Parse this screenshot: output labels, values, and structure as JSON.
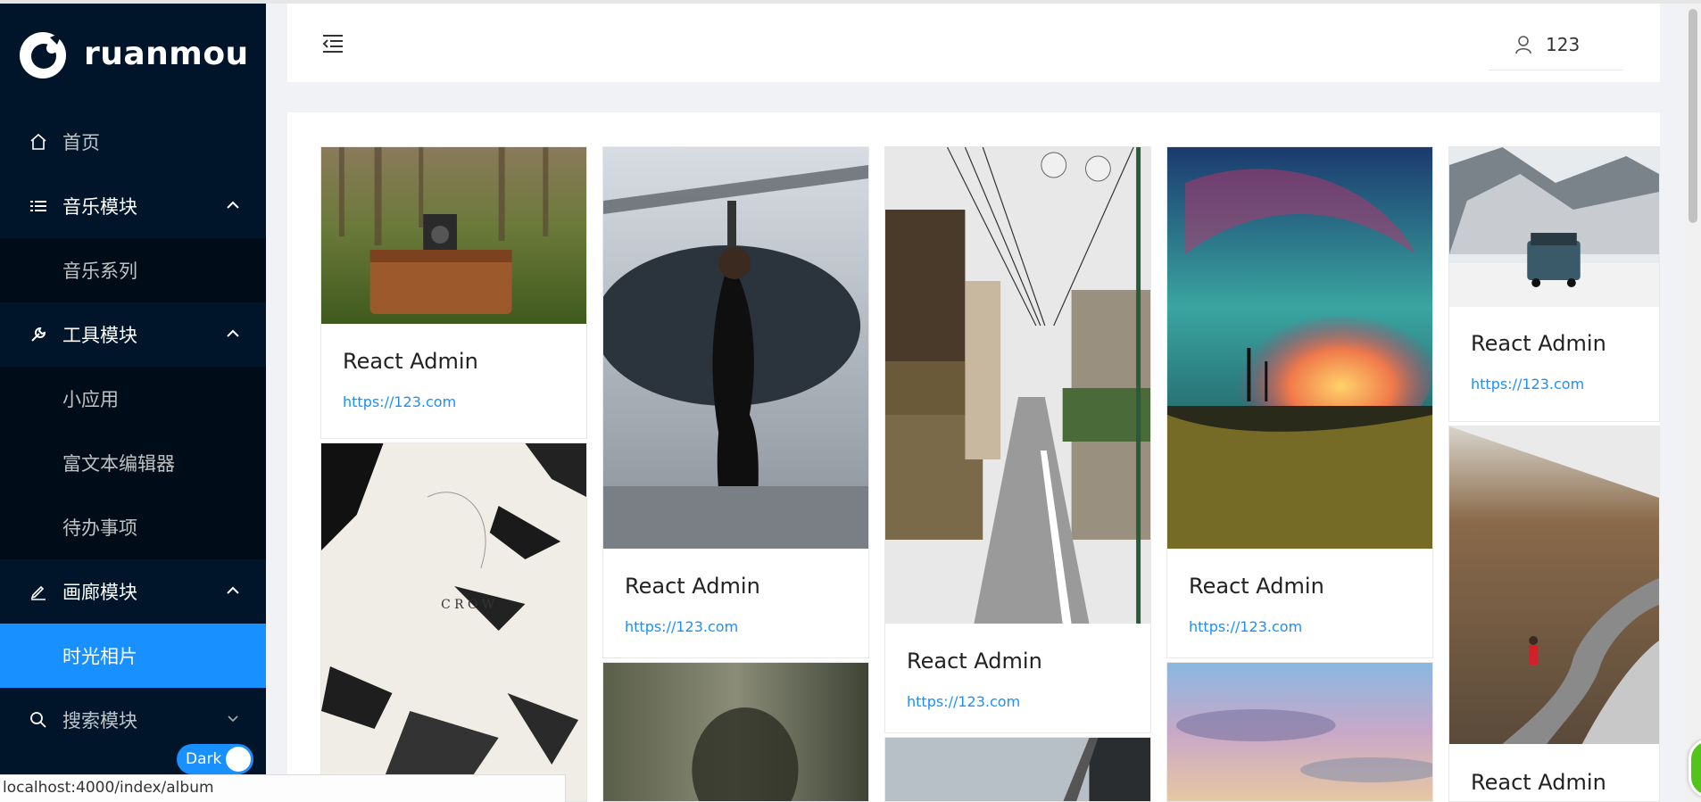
{
  "brand": {
    "name": "ruanmou"
  },
  "sidebar": {
    "items": [
      {
        "label": "首页",
        "icon": "home-icon"
      },
      {
        "label": "音乐模块",
        "icon": "list-icon",
        "expanded": true
      },
      {
        "label": "音乐系列"
      },
      {
        "label": "工具模块",
        "icon": "tool-icon",
        "expanded": true
      },
      {
        "label": "小应用"
      },
      {
        "label": "富文本编辑器"
      },
      {
        "label": "待办事项"
      },
      {
        "label": "画廊模块",
        "icon": "edit-icon",
        "expanded": true
      },
      {
        "label": "时光相片",
        "active": true
      },
      {
        "label": "搜索模块",
        "icon": "search-icon",
        "expanded": false
      }
    ],
    "theme_toggle": {
      "label": "Dark",
      "on": true
    }
  },
  "header": {
    "user": {
      "name": "123",
      "icon": "user-icon"
    }
  },
  "gallery": {
    "cards": [
      {
        "title": "React Admin",
        "link": "https://123.com",
        "image": "vintage camera on suitcase in forest"
      },
      {
        "title": "React Admin",
        "link": "https://123.com",
        "image": "woman in black dress by helicopter"
      },
      {
        "title": "React Admin",
        "link": "https://123.com",
        "image": "narrow japanese shopping street"
      },
      {
        "title": "React Admin",
        "link": "https://123.com",
        "image": "colorful ocean wave at sunset"
      },
      {
        "title": "React Admin",
        "link": "https://123.com",
        "image": "jeep on snowy mountain road"
      },
      {
        "title": "React Admin",
        "image": "skateboarder on winding mountain road"
      }
    ],
    "crow_text": "C R O W"
  },
  "status_bar": {
    "url": "localhost:4000/index/album"
  },
  "colors": {
    "sidebar_bg": "#001529",
    "submenu_bg": "#000c17",
    "accent": "#1890ff",
    "link": "#1890ff"
  }
}
